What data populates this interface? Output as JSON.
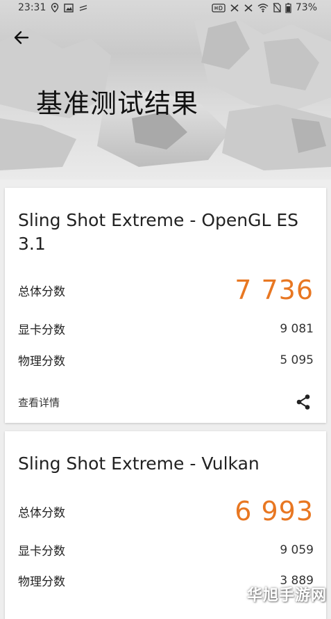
{
  "status_bar": {
    "time": "23:31",
    "battery": "73%"
  },
  "header": {
    "title": "基准测试结果"
  },
  "results": [
    {
      "test_name": "Sling Shot Extreme - OpenGL ES 3.1",
      "overall_label": "总体分数",
      "overall_score": "7 736",
      "graphics_label": "显卡分数",
      "graphics_score": "9 081",
      "physics_label": "物理分数",
      "physics_score": "5 095",
      "details_label": "查看详情"
    },
    {
      "test_name": "Sling Shot Extreme - Vulkan",
      "overall_label": "总体分数",
      "overall_score": "6 993",
      "graphics_label": "显卡分数",
      "graphics_score": "9 059",
      "physics_label": "物理分数",
      "physics_score": "3 889"
    }
  ],
  "colors": {
    "accent_score": "#e87722",
    "card_background": "#ffffff",
    "page_background": "#eeeeee"
  },
  "icons": {
    "back": "arrow-left-icon",
    "share": "share-icon"
  },
  "watermark": "华旭手游网"
}
